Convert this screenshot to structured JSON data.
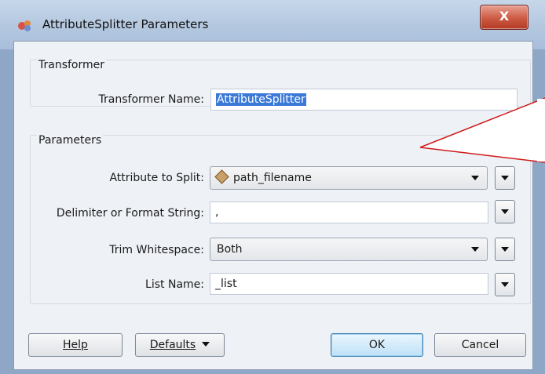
{
  "window": {
    "title": "AttributeSplitter Parameters",
    "close_label": "X"
  },
  "transformer_group": {
    "title": "Transformer",
    "name_label": "Transformer Name:",
    "name_value": "AttributeSplitter"
  },
  "parameters_group": {
    "title": "Parameters",
    "attribute_label": "Attribute to Split:",
    "attribute_value": "path_filename",
    "delimiter_label": "Delimiter or Format String:",
    "delimiter_value": ",",
    "trim_label": "Trim Whitespace:",
    "trim_value": "Both",
    "list_label": "List Name:",
    "list_value": "_list"
  },
  "buttons": {
    "help": "Help",
    "defaults": "Defaults",
    "ok": "OK",
    "cancel": "Cancel"
  },
  "colors": {
    "selection": "#3b79d8",
    "callout": "#d11a1a",
    "close_button": "#cc5a43"
  }
}
